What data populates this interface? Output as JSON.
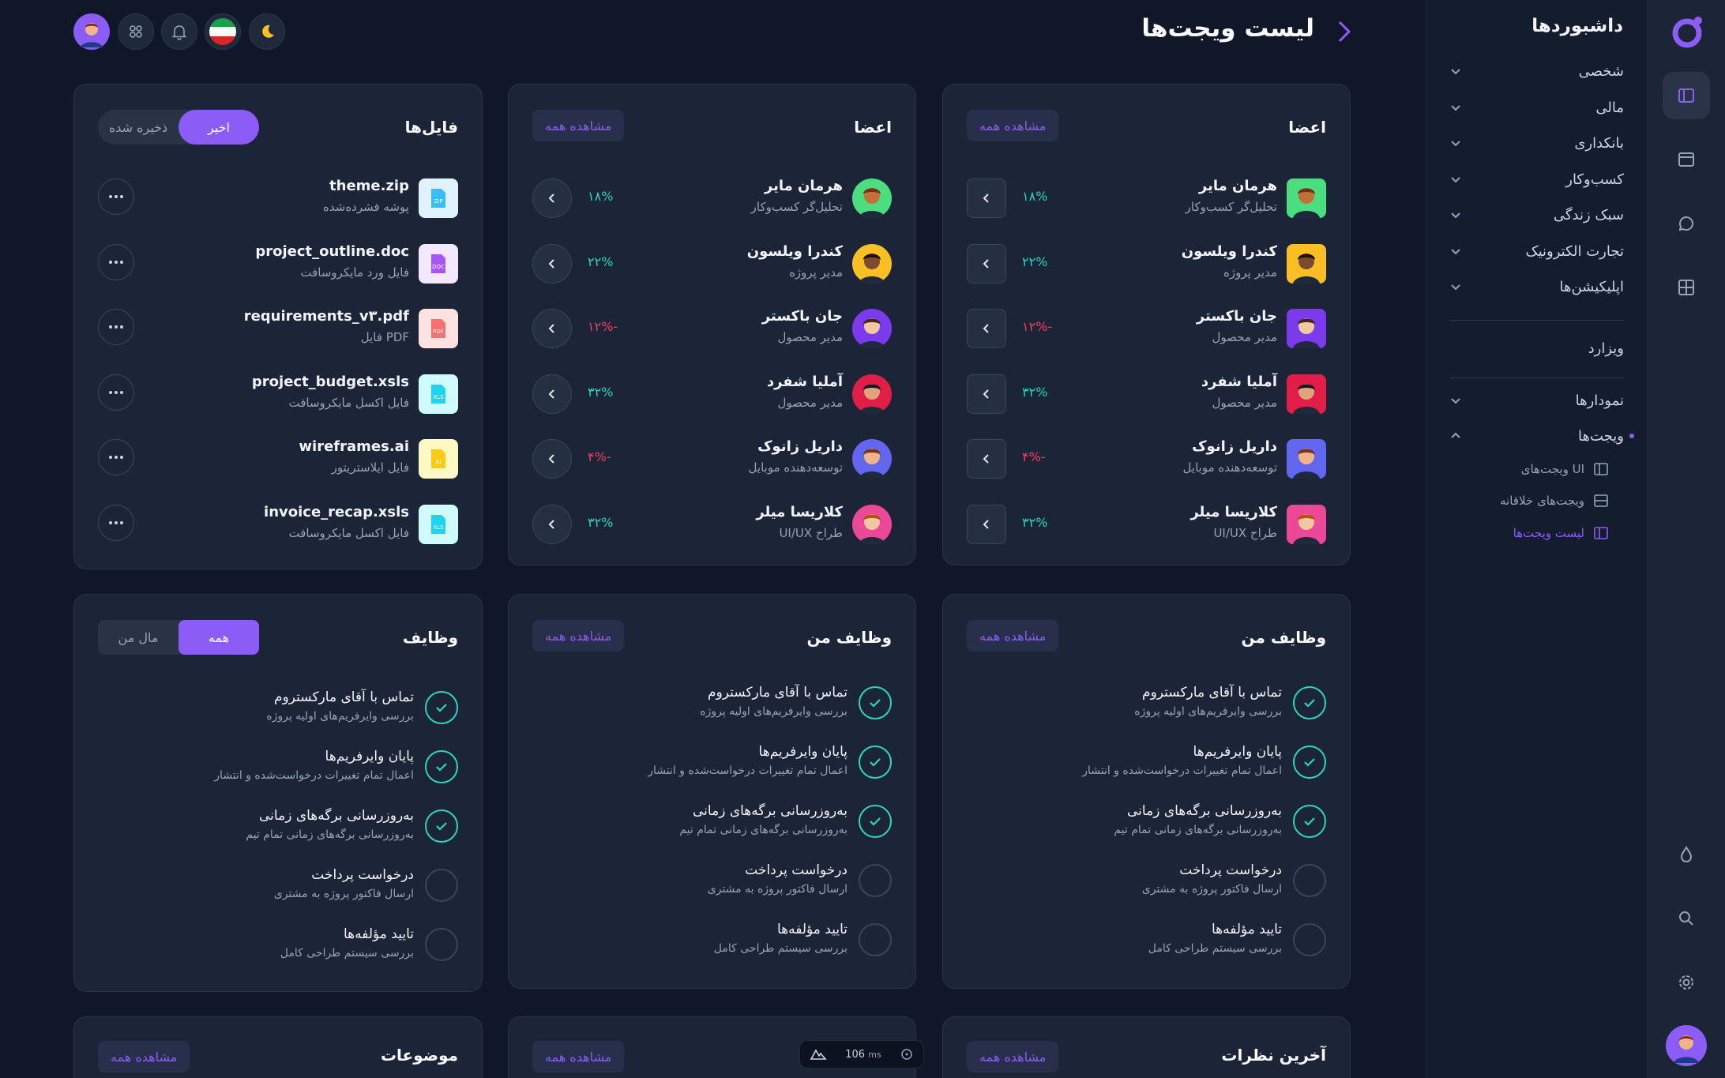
{
  "app": {
    "brand": "داشبوردها",
    "page_title": "لیست ویجت‌ها"
  },
  "colors": {
    "accent": "#8b5cf6",
    "positive": "#2dd4bf",
    "negative": "#f43f5e",
    "background": "#0f1728",
    "card": "#1c2537"
  },
  "rail": {
    "icons": [
      "sidebar-icon",
      "browser-window-icon",
      "chat-bubble-icon",
      "grid-icon",
      "water-drop-icon",
      "search-icon",
      "gear-icon"
    ]
  },
  "sidebar": {
    "items": [
      {
        "label": "شخصی"
      },
      {
        "label": "مالی"
      },
      {
        "label": "بانکداری"
      },
      {
        "label": "کسب‌وکار"
      },
      {
        "label": "سبک زندگی"
      },
      {
        "label": "تجارت الکترونیک"
      },
      {
        "label": "اپلیکیشن‌ها"
      }
    ],
    "wizard": "ویزارد",
    "charts": "نمودارها",
    "widgets": "ویجت‌ها",
    "widget_sub": [
      {
        "label": "ویجت‌های UI"
      },
      {
        "label": "ویجت‌های خلاقانه"
      },
      {
        "label": "لیست ویجت‌ها"
      }
    ]
  },
  "members": {
    "title": "اعضا",
    "view_all": "مشاهده همه",
    "rows": [
      {
        "name": "هرمان مایر",
        "role": "تحلیل‌گر کسب‌وکار",
        "change": "۱۸%",
        "trend": "up"
      },
      {
        "name": "کندرا ویلسون",
        "role": "مدیر پروژه",
        "change": "۲۲%",
        "trend": "up"
      },
      {
        "name": "جان باکستر",
        "role": "مدیر محصول",
        "change": "۱۲%-",
        "trend": "down"
      },
      {
        "name": "آملیا شفرد",
        "role": "مدیر محصول",
        "change": "۳۲%",
        "trend": "up"
      },
      {
        "name": "داریل زانوک",
        "role": "توسعه‌دهنده موبایل",
        "change": "۴%-",
        "trend": "down"
      },
      {
        "name": "کلاریسا میلر",
        "role": "UI/UX طراح",
        "change": "۳۲%",
        "trend": "up"
      }
    ]
  },
  "files": {
    "title": "فایل‌ها",
    "tabs": [
      "اخیر",
      "ذخیره شده"
    ],
    "rows": [
      {
        "name": "theme.zip",
        "type": "پوشه فشرده‌شده",
        "badge": "ZIP",
        "color": "#38bdf8",
        "bg": "#e0f2fe"
      },
      {
        "name": "project_outline.doc",
        "type": "فایل ورد مایکروسافت",
        "badge": "DOC",
        "color": "#a855f7",
        "bg": "#f3e8ff"
      },
      {
        "name": "requirements_v۳.pdf",
        "type": "فایل PDF",
        "badge": "PDF",
        "color": "#f87171",
        "bg": "#fee2e2"
      },
      {
        "name": "project_budget.xsls",
        "type": "فایل اکسل مایکروسافت",
        "badge": "XLS",
        "color": "#22d3ee",
        "bg": "#cffafe"
      },
      {
        "name": "wireframes.ai",
        "type": "فایل ایلاستریتور",
        "badge": "AI",
        "color": "#facc15",
        "bg": "#fef9c3"
      },
      {
        "name": "invoice_recap.xsls",
        "type": "فایل اکسل مایکروسافت",
        "badge": "XLS",
        "color": "#22d3ee",
        "bg": "#cffafe"
      }
    ]
  },
  "tasks": {
    "my_title": "وظایف من",
    "title": "وظایف",
    "view_all": "مشاهده همه",
    "tabs": [
      "همه",
      "مال من"
    ],
    "rows": [
      {
        "title": "تماس با آقای مارکستروم",
        "sub": "بررسی وایرفریم‌های اولیه پروژه",
        "done": true
      },
      {
        "title": "پایان وایرفریم‌ها",
        "sub": "اعمال تمام تغییرات درخواست‌شده و انتشار",
        "done": true
      },
      {
        "title": "به‌روزرسانی برگه‌های زمانی",
        "sub": "به‌روزرسانی برگه‌های زمانی تمام تیم",
        "done": true
      },
      {
        "title": "درخواست پرداخت",
        "sub": "ارسال فاکتور پروژه به مشتری",
        "done": false
      },
      {
        "title": "تایید مؤلفه‌ها",
        "sub": "بررسی سیستم طراحی کامل",
        "done": false
      }
    ]
  },
  "bottom": {
    "comments_title": "آخرین نظرات",
    "topics_title": "موضوعات",
    "view_all": "مشاهده همه"
  },
  "perf": {
    "value": "106",
    "unit": "ms"
  }
}
